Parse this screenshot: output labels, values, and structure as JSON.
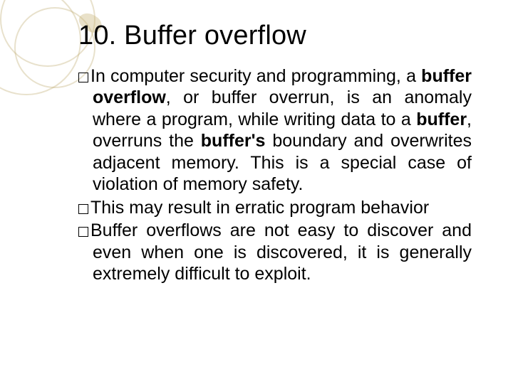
{
  "title": "10. Buffer overflow",
  "p1": {
    "t1": "In computer security and programming, a ",
    "b1": "buffer overflow",
    "t2": ", or buffer overrun, is an anomaly where a program, while writing data to a ",
    "b2": "buffer",
    "t3": ", overruns the ",
    "b3": "buffer's",
    "t4": " boundary and overwrites adjacent memory. This is a special case of violation of memory safety."
  },
  "p2": "This may result in erratic program behavior",
  "p3": "Buffer overflows are not easy to discover and even when one is discovered, it is generally extremely difficult to exploit."
}
